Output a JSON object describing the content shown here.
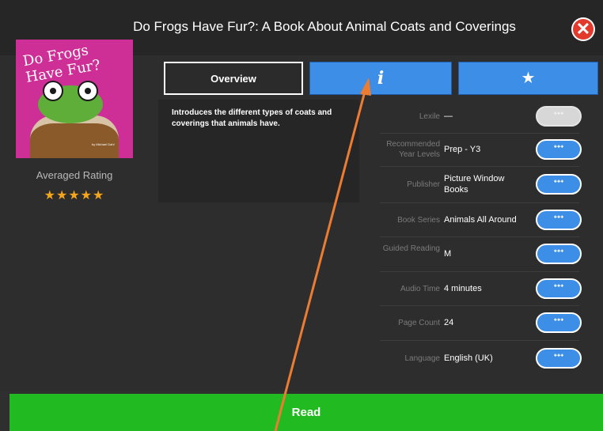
{
  "header": {
    "title": "Do Frogs Have Fur?: A Book About Animal Coats and Coverings",
    "close_icon": "close-icon"
  },
  "cover": {
    "title_text": "Do Frogs Have Fur?",
    "credit": "by Michael Dahl"
  },
  "rating": {
    "label": "Averaged Rating",
    "stars": "★★★★★",
    "value_stars": 5
  },
  "tabs": {
    "overview": "Overview",
    "info": "i",
    "favorite": "★"
  },
  "description": "Introduces the different types of coats and coverings that animals have.",
  "meta": [
    {
      "label": "Lexile",
      "value": "—",
      "enabled": false
    },
    {
      "label": "Recommended Year Levels",
      "value": "Prep - Y3",
      "enabled": true
    },
    {
      "label": "Publisher",
      "value": "Picture Window Books",
      "enabled": true
    },
    {
      "label": "Book Series",
      "value": "Animals All Around",
      "enabled": true
    },
    {
      "label": "Guided Reading",
      "value": "M",
      "enabled": true
    },
    {
      "label": "Audio Time",
      "value": "4 minutes",
      "enabled": true
    },
    {
      "label": "Page Count",
      "value": "24",
      "enabled": true
    },
    {
      "label": "Language",
      "value": "English (UK)",
      "enabled": true
    }
  ],
  "pill_icon": "related-icon",
  "pill_glyph": "ᐩᐩᐩ",
  "read_button": "Read",
  "colors": {
    "accent_blue": "#3c8ee6",
    "read_green": "#21bb21",
    "close_red": "#e23b2e",
    "star_gold": "#f2a51d",
    "annotation_arrow": "#ec7c32"
  }
}
